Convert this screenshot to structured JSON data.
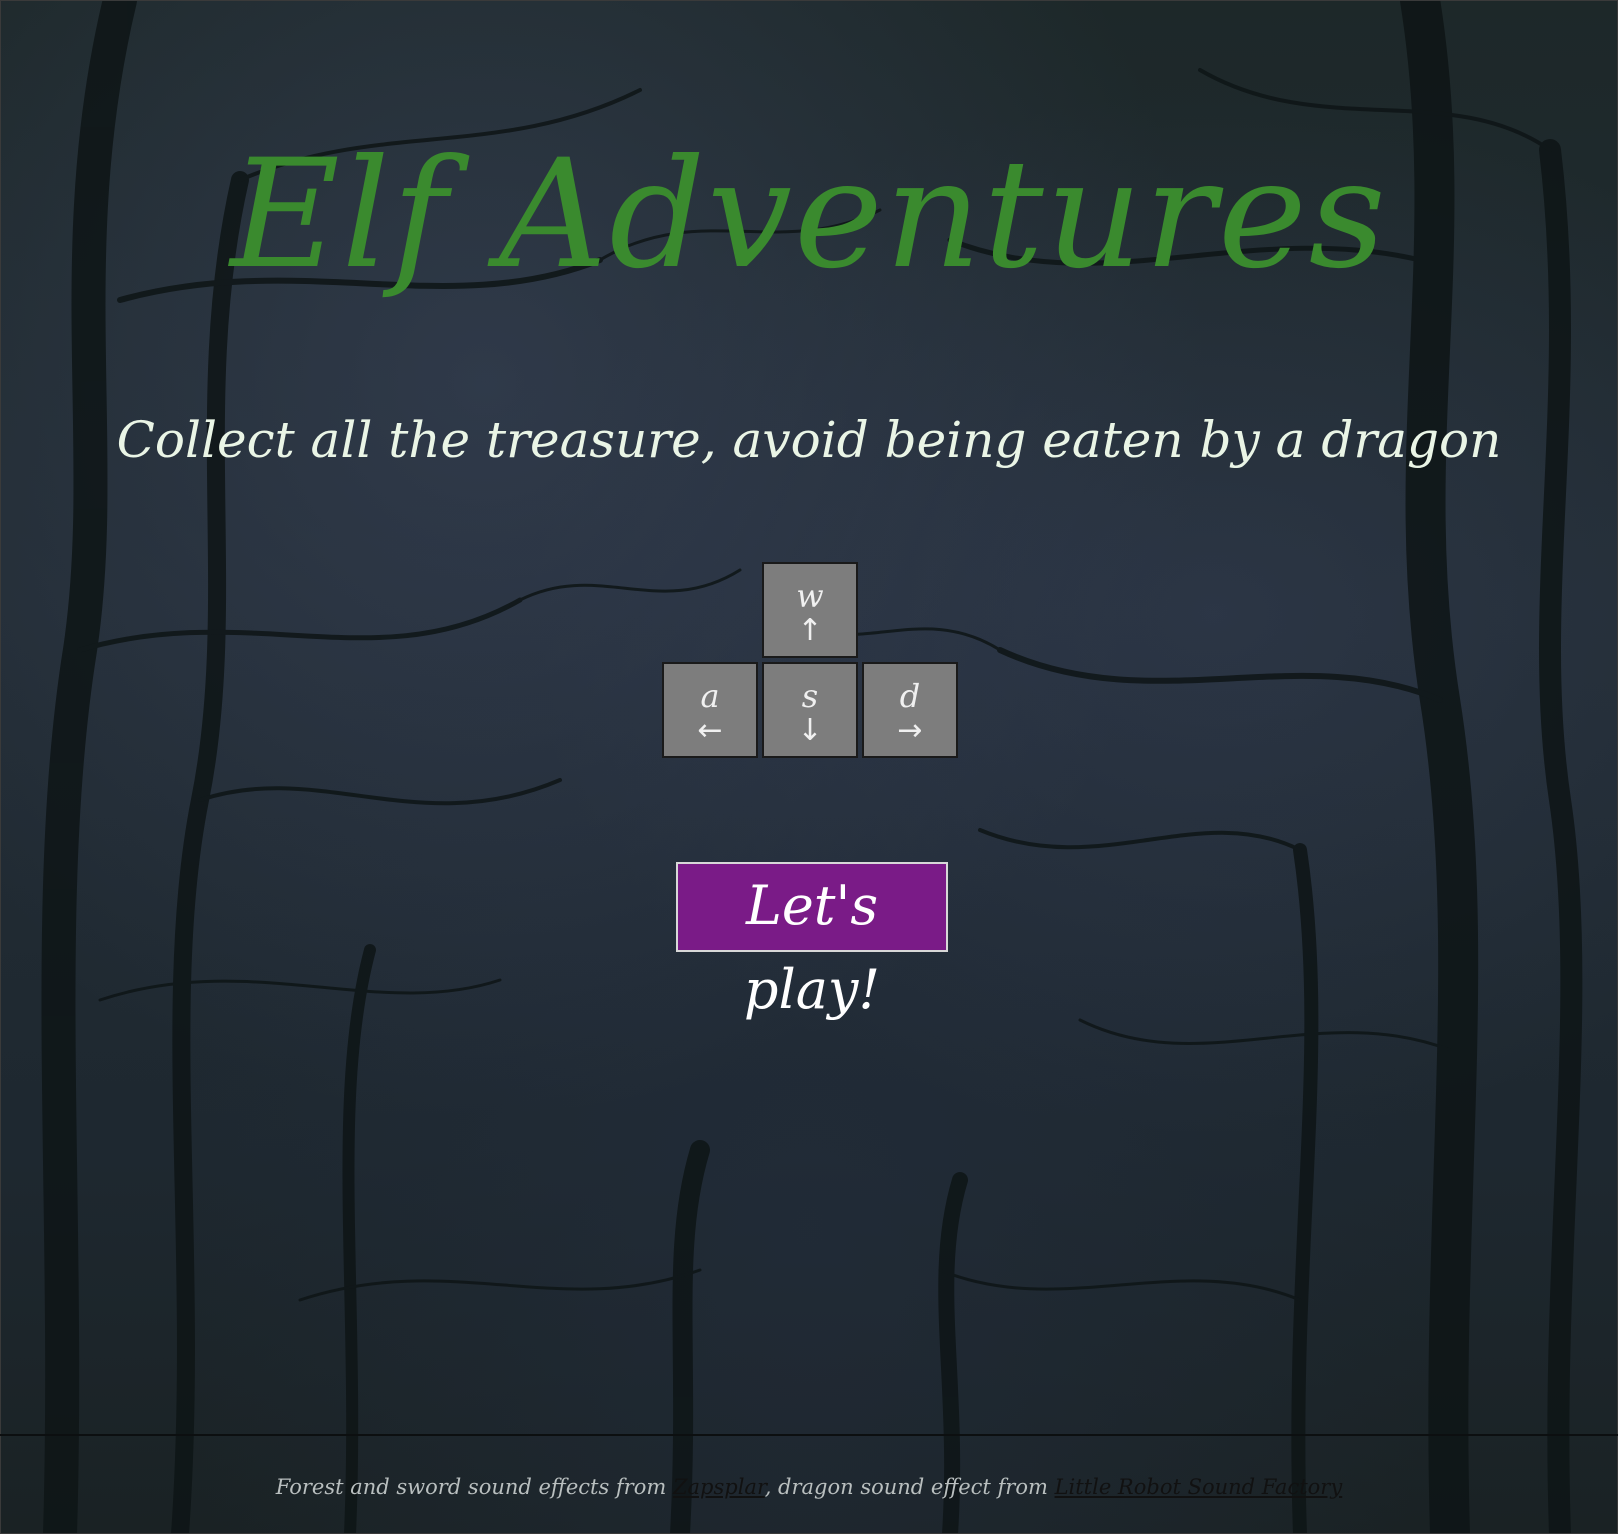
{
  "title": "Elf Adventures",
  "subtitle": "Collect all the treasure, avoid being eaten by a dragon",
  "controls": {
    "w": {
      "letter": "w",
      "arrow": "↑"
    },
    "a": {
      "letter": "a",
      "arrow": "←"
    },
    "s": {
      "letter": "s",
      "arrow": "↓"
    },
    "d": {
      "letter": "d",
      "arrow": "→"
    }
  },
  "play_button": {
    "label": "Let's play!"
  },
  "footer": {
    "text_before": "Forest and sword sound effects from ",
    "link1": "Zapsplar",
    "text_middle": ", dragon sound effect from ",
    "link2": "Little Robot Sound Factory"
  },
  "colors": {
    "title": "#3a8a2e",
    "subtitle": "#eaf5e6",
    "key_bg": "#7d7d7d",
    "button_bg": "#7a1b87",
    "background": "#1f2a2c"
  }
}
